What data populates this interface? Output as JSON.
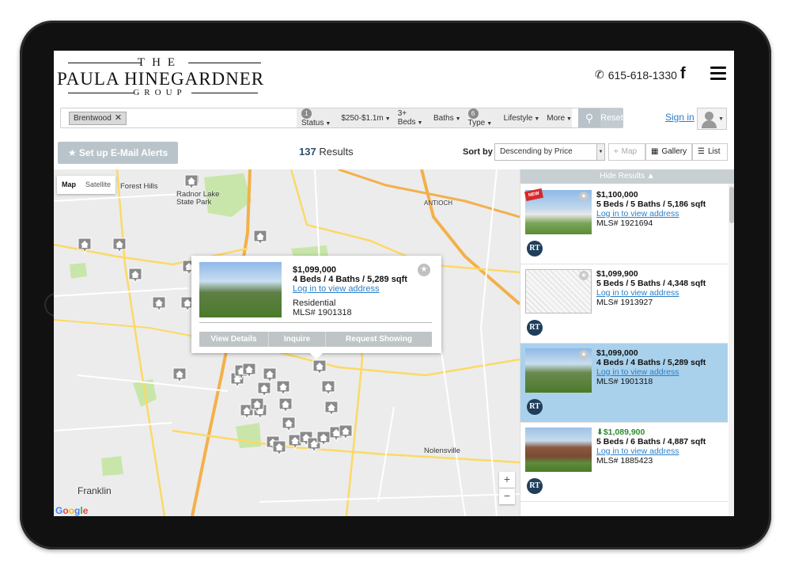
{
  "header": {
    "logo_top": "THE",
    "logo_name": "PAULA HINEGARDNER",
    "logo_bottom": "GROUP",
    "phone": "615-618-1330",
    "facebook_icon": "facebook-icon",
    "menu_icon": "hamburger-icon"
  },
  "search": {
    "tag_label": "Brentwood",
    "filters": [
      {
        "badge": "1",
        "label": "Status"
      },
      {
        "badge": "",
        "label": "$250-$1.1m"
      },
      {
        "badge": "",
        "label": "3+ Beds"
      },
      {
        "badge": "",
        "label": "Baths"
      },
      {
        "badge": "6",
        "label": "Type"
      },
      {
        "badge": "",
        "label": "Lifestyle"
      },
      {
        "badge": "",
        "label": "More"
      }
    ],
    "reset_label": "Reset",
    "signin_label": "Sign in"
  },
  "toolbar": {
    "alerts_label": "Set up E-Mail Alerts",
    "results_count": "137",
    "results_label": "Results",
    "sortby_label": "Sort by",
    "sort_value": "Descending by Price",
    "view_map": "Map",
    "view_gallery": "Gallery",
    "view_list": "List"
  },
  "map": {
    "toggle_map": "Map",
    "toggle_satellite": "Satellite",
    "places": [
      {
        "name": "Forest Hills"
      },
      {
        "name": "Radnor Lake"
      },
      {
        "name": "State Park"
      },
      {
        "name": "ANTIOCH"
      },
      {
        "name": "Nolensville"
      },
      {
        "name": "Franklin"
      }
    ],
    "zoom_in": "+",
    "zoom_out": "−",
    "google_label": "Google"
  },
  "popup": {
    "price": "$1,099,000",
    "beds": "4 Beds / 4 Baths / 5,289 sqft",
    "login": "Log in to view address",
    "type": "Residential",
    "mls": "MLS# 1901318",
    "actions": [
      "View Details",
      "Inquire",
      "Request Showing"
    ]
  },
  "results": {
    "hide_label": "Hide Results",
    "listings": [
      {
        "price": "$1,100,000",
        "beds": "5 Beds / 5 Baths / 5,186 sqft",
        "login": "Log in to view address",
        "mls": "MLS# 1921694",
        "new": true,
        "reduced": false
      },
      {
        "price": "$1,099,900",
        "beds": "5 Beds / 5 Baths / 4,348 sqft",
        "login": "Log in to view address",
        "mls": "MLS# 1913927",
        "new": false,
        "reduced": false
      },
      {
        "price": "$1,099,000",
        "beds": "4 Beds / 4 Baths / 5,289 sqft",
        "login": "Log in to view address",
        "mls": "MLS# 1901318",
        "new": false,
        "reduced": false
      },
      {
        "price": "$1,089,900",
        "beds": "5 Beds / 6 Baths / 4,887 sqft",
        "login": "Log in to view address",
        "mls": "MLS# 1885423",
        "new": false,
        "reduced": true
      }
    ],
    "new_label": "NEW",
    "brand_mark": "RT"
  },
  "colors": {
    "link": "#2a7fc7",
    "highlight": "#a9d1ec",
    "reduced_price": "#2e8b2e"
  }
}
